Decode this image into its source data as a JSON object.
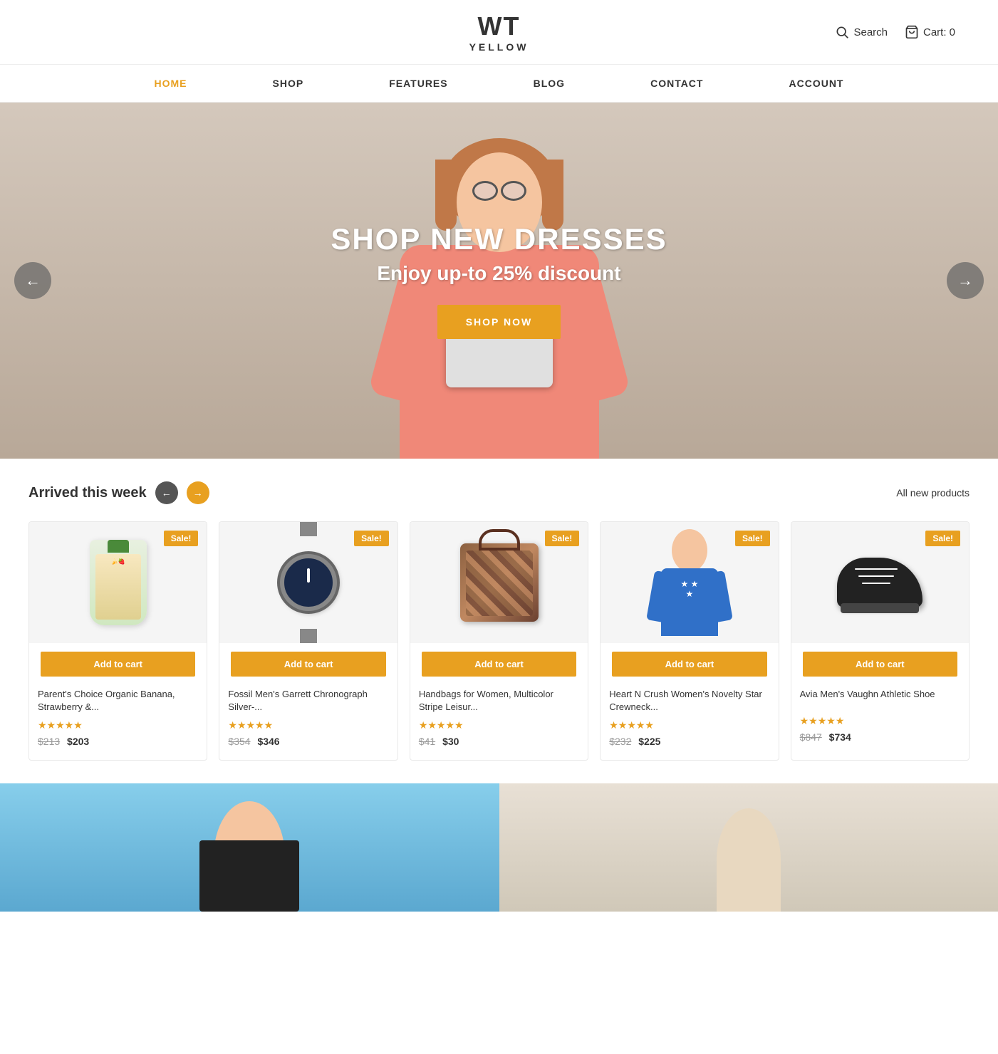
{
  "logo": {
    "top": "WT",
    "sub": "YELLOW"
  },
  "header": {
    "search_label": "Search",
    "cart_label": "Cart: 0"
  },
  "nav": {
    "items": [
      {
        "id": "home",
        "label": "HOME",
        "active": true
      },
      {
        "id": "shop",
        "label": "SHOP",
        "active": false
      },
      {
        "id": "features",
        "label": "FEATURES",
        "active": false
      },
      {
        "id": "blog",
        "label": "BLOG",
        "active": false
      },
      {
        "id": "contact",
        "label": "CONTACT",
        "active": false
      },
      {
        "id": "account",
        "label": "ACCOUNT",
        "active": false
      }
    ]
  },
  "hero": {
    "title": "SHOP NEW DRESSES",
    "subtitle": "Enjoy up-to 25% discount",
    "button_label": "SHOP NOW",
    "prev_arrow": "←",
    "next_arrow": "→"
  },
  "products_section": {
    "title": "Arrived this week",
    "all_link": "All new products",
    "products": [
      {
        "id": 1,
        "name": "Parent's Choice Organic Banana, Strawberry &...",
        "badge": "Sale!",
        "old_price": "$213",
        "new_price": "$203",
        "stars": "★★★★★",
        "add_to_cart": "Add to cart",
        "type": "food"
      },
      {
        "id": 2,
        "name": "Fossil Men's Garrett Chronograph Silver-...",
        "badge": "Sale!",
        "old_price": "$354",
        "new_price": "$346",
        "stars": "★★★★★",
        "add_to_cart": "Add to cart",
        "type": "watch"
      },
      {
        "id": 3,
        "name": "Handbags for Women, Multicolor Stripe Leisur...",
        "badge": "Sale!",
        "old_price": "$41",
        "new_price": "$30",
        "stars": "★★★★★",
        "add_to_cart": "Add to cart",
        "type": "bag"
      },
      {
        "id": 4,
        "name": "Heart N Crush Women's Novelty Star Crewneck...",
        "badge": "Sale!",
        "old_price": "$232",
        "new_price": "$225",
        "stars": "★★★★★",
        "add_to_cart": "Add to cart",
        "type": "sweater"
      },
      {
        "id": 5,
        "name": "Avia Men's Vaughn Athletic Shoe",
        "badge": "Sale!",
        "old_price": "$847",
        "new_price": "$734",
        "stars": "★★★★★",
        "add_to_cart": "Add to cart",
        "type": "shoe"
      }
    ]
  },
  "colors": {
    "accent": "#e8a020",
    "nav_active": "#e8a020"
  }
}
